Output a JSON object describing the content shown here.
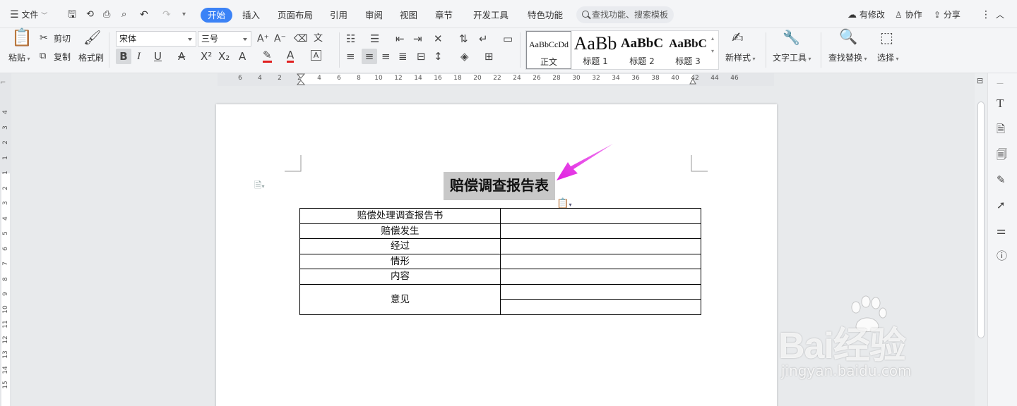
{
  "menu": {
    "file_label": "文件"
  },
  "tabs": [
    {
      "label": "开始",
      "active": true
    },
    {
      "label": "插入"
    },
    {
      "label": "页面布局"
    },
    {
      "label": "引用"
    },
    {
      "label": "审阅"
    },
    {
      "label": "视图"
    },
    {
      "label": "章节"
    },
    {
      "label": "开发工具"
    },
    {
      "label": "特色功能"
    }
  ],
  "search": {
    "placeholder": "查找功能、搜索模板"
  },
  "header_right": {
    "changes": "有修改",
    "collab": "协作",
    "share": "分享"
  },
  "ribbon": {
    "paste": "粘贴",
    "cut": "剪切",
    "copy": "复制",
    "format_painter": "格式刷",
    "font_name": "宋体",
    "font_size": "三号",
    "styles": [
      {
        "preview": "AaBbCcDd",
        "label": "正文"
      },
      {
        "preview": "AaBb",
        "label": "标题 1"
      },
      {
        "preview": "AaBbC",
        "label": "标题 2"
      },
      {
        "preview": "AaBbC",
        "label": "标题 3"
      }
    ],
    "new_style": "新样式",
    "text_tools": "文字工具",
    "find_replace": "查找替换",
    "select": "选择"
  },
  "ruler": {
    "h_ticks": [
      "6",
      "4",
      "2",
      "2",
      "4",
      "6",
      "8",
      "10",
      "12",
      "14",
      "16",
      "18",
      "20",
      "22",
      "24",
      "26",
      "28",
      "30",
      "32",
      "34",
      "36",
      "38",
      "40",
      "42",
      "44",
      "46"
    ],
    "v_ticks": [
      "4",
      "3",
      "2",
      "1",
      "1",
      "2",
      "3",
      "4",
      "5",
      "6",
      "7",
      "8",
      "9",
      "10",
      "11",
      "12",
      "13",
      "14",
      "15"
    ]
  },
  "document": {
    "title": "赔偿调查报告表",
    "table": [
      {
        "left": "赔偿处理调查报告书",
        "right": ""
      },
      {
        "left": "赔偿发生",
        "right": ""
      },
      {
        "left": "经过",
        "right": ""
      },
      {
        "left": "情形",
        "right": ""
      },
      {
        "left": "内容",
        "right": ""
      },
      {
        "left": "意见",
        "right": ""
      }
    ]
  },
  "watermark": {
    "brand": "Bai经验",
    "url": "jingyan.baidu.com"
  },
  "colors": {
    "accent": "#3b82f6",
    "arrow": "#e83ee8",
    "selection": "#c8c8c8"
  }
}
